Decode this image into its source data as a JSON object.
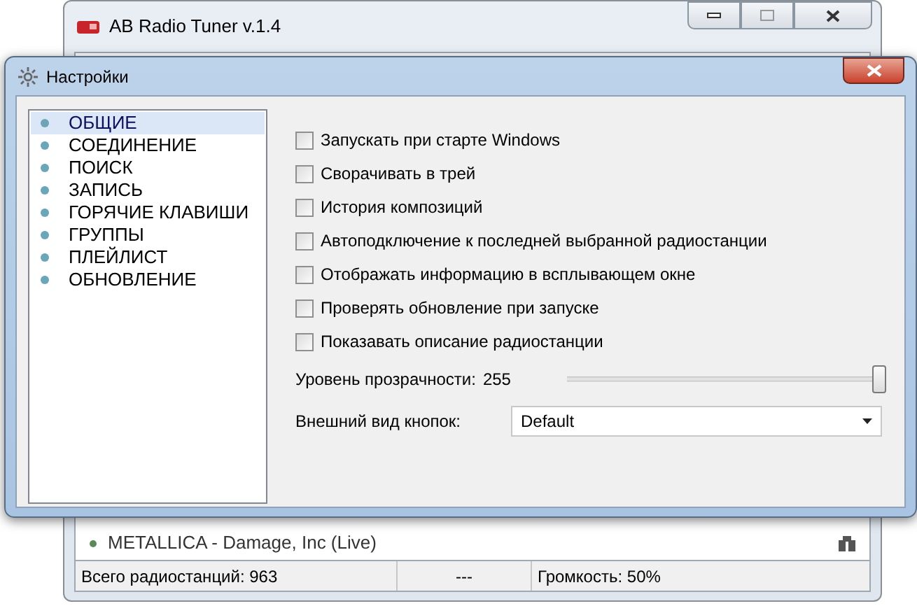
{
  "main_window": {
    "title": "AB Radio Tuner v.1.4",
    "now_playing": "METALLICA - Damage, Inc (Live)",
    "status_bar": {
      "total": "Всего радиостанций: 963",
      "middle": "---",
      "volume": "Громкость: 50%"
    }
  },
  "dialog": {
    "title": "Настройки",
    "sections": [
      {
        "label": "ОБЩИЕ",
        "selected": true
      },
      {
        "label": "СОЕДИНЕНИЕ",
        "selected": false
      },
      {
        "label": "ПОИСК",
        "selected": false
      },
      {
        "label": "ЗАПИСЬ",
        "selected": false
      },
      {
        "label": "ГОРЯЧИЕ КЛАВИШИ",
        "selected": false
      },
      {
        "label": "ГРУППЫ",
        "selected": false
      },
      {
        "label": "ПЛЕЙЛИСТ",
        "selected": false
      },
      {
        "label": "ОБНОВЛЕНИЕ",
        "selected": false
      }
    ],
    "options": [
      {
        "kind": "checkbox",
        "label": "Запускать при старте Windows",
        "checked": false
      },
      {
        "kind": "checkbox",
        "label": "Сворачивать в трей",
        "checked": false
      },
      {
        "kind": "checkbox",
        "label": "История композиций",
        "checked": false
      },
      {
        "kind": "checkbox",
        "label": "Автоподключение к последней выбранной радиостанции",
        "checked": false
      },
      {
        "kind": "checkbox",
        "label": "Отображать информацию в всплывающем окне",
        "checked": false
      },
      {
        "kind": "checkbox",
        "label": "Проверять обновление при запуске",
        "checked": false
      },
      {
        "kind": "checkbox",
        "label": "Показавать описание радиостанции",
        "checked": false
      },
      {
        "kind": "slider",
        "label": "Уровень прозрачности:",
        "reading": "255",
        "level": 1.0
      },
      {
        "kind": "dropdown",
        "label": "Внешний вид кнопок:",
        "value": "Default"
      }
    ]
  }
}
